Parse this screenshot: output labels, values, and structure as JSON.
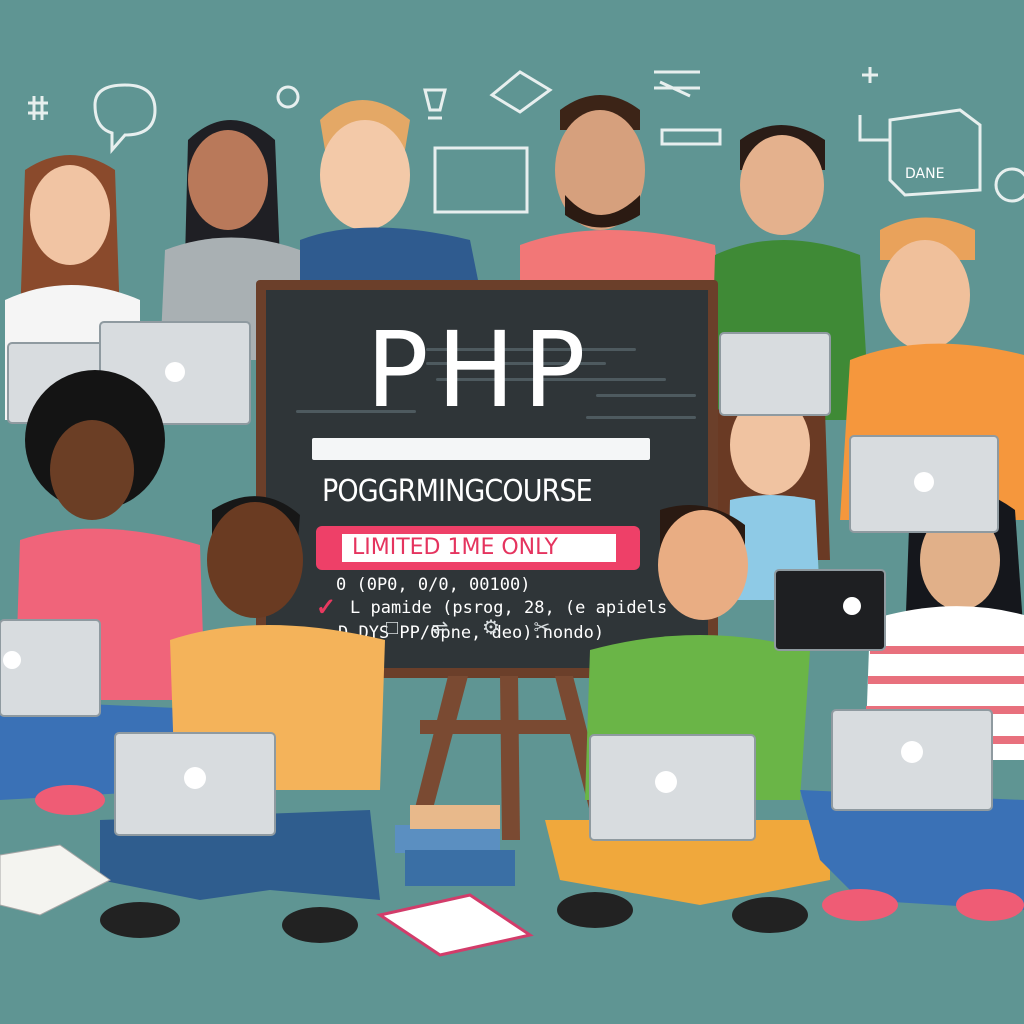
{
  "board": {
    "title": "PHP",
    "subtitle": "POGGRMINGCOURSE",
    "promo": "LIMITED 1ME ONLY",
    "line1": "0 (0P0, 0/0, 00100)",
    "line2": "L pamide (psrog, 28, (e apidels",
    "line3": "D DYS PP/0pne, deo).nondo)",
    "check_icon": "check-icon",
    "icons": [
      "□",
      "⇌",
      "⚙",
      "✂"
    ]
  },
  "doodles": {
    "book_stack_label": "DANE",
    "speech_bubble_text": "..."
  },
  "colors": {
    "background": "#5f9593",
    "board_frame": "#6b3f2a",
    "board_surface": "#2f3538",
    "promo_accent": "#ee4068",
    "laptop": "#d8dcdf"
  }
}
